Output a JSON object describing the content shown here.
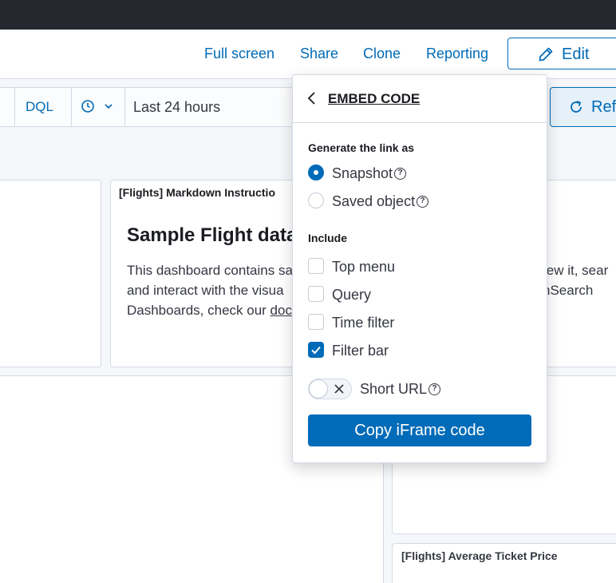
{
  "header": {
    "links": [
      {
        "label": "Full screen"
      },
      {
        "label": "Share"
      },
      {
        "label": "Clone"
      },
      {
        "label": "Reporting"
      }
    ],
    "edit_label": "Edit"
  },
  "query_bar": {
    "language_label": "DQL",
    "time_range": "Last 24 hours",
    "refresh_label": "Ref"
  },
  "panels": {
    "markdown_title": "[Flights] Markdown Instructio",
    "markdown_heading": "Sample Flight data",
    "markdown_lines": [
      "This dashboard contains sa",
      "and interact with the visua",
      "Dashboards, check our "
    ],
    "markdown_link": "doc",
    "right_lines": [
      "iew it, sear",
      "nSearch"
    ],
    "ticket_title": "[Flights] Average Ticket Price"
  },
  "embed_popover": {
    "title": "EMBED CODE",
    "generate_label": "Generate the link as",
    "snapshot_label": "Snapshot",
    "saved_object_label": "Saved object",
    "selected_mode": "Snapshot",
    "include_label": "Include",
    "include_options": [
      {
        "label": "Top menu",
        "checked": false
      },
      {
        "label": "Query",
        "checked": false
      },
      {
        "label": "Time filter",
        "checked": false
      },
      {
        "label": "Filter bar",
        "checked": true
      }
    ],
    "short_url_label": "Short URL",
    "short_url_on": false,
    "copy_button_label": "Copy iFrame code"
  },
  "icons": [
    "pencil-icon",
    "clock-icon",
    "chevron-down-icon",
    "refresh-icon",
    "arrow-left-icon",
    "help-icon",
    "checkmark-icon",
    "close-icon"
  ],
  "colors": {
    "accent": "#006bb8",
    "topbar": "#25282f",
    "border": "#d3dae6"
  }
}
